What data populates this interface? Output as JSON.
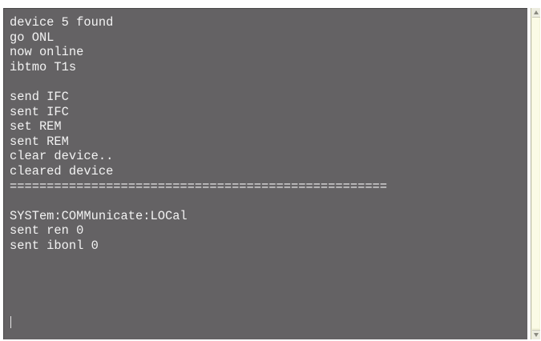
{
  "console": {
    "lines": [
      "device 5 found",
      "go ONL",
      "now online",
      "ibtmo T1s",
      "",
      "send IFC",
      "sent IFC",
      "set REM",
      "sent REM",
      "clear device..",
      "cleared device",
      "===================================================",
      "",
      "SYSTem:COMMunicate:LOCal",
      "sent ren 0",
      "sent ibonl 0"
    ]
  },
  "colors": {
    "console_background": "#646264",
    "console_text": "#f2f2f2",
    "scrollbar_track": "#f4f4da"
  },
  "icons": {
    "scroll_up": "triangle-up-icon",
    "scroll_down": "triangle-down-icon"
  }
}
